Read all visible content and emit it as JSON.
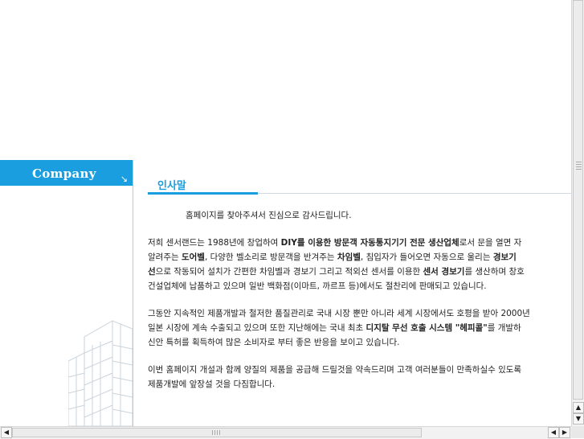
{
  "sidebar": {
    "title": "Company",
    "arrow_icon": "↘",
    "illustration": "building-illustration"
  },
  "content": {
    "title": "인사말",
    "greeting": "홈페이지를 찾아주셔서 진심으로 감사드립니다.",
    "p1": {
      "l1a": "저희 센서랜드는 1988년에 창업하여 ",
      "l1b": "DIY를 이용한 방문객 자동통지기기 전문 생산업체",
      "l1c": "로서 문을 열면 자",
      "l2a": "알려주는 ",
      "l2b": "도어벨",
      "l2c": ", 다양한 벨소리로 방문객을 반겨주는 ",
      "l2d": "차임벨",
      "l2e": ", 침입자가 들어오면 자동으로 울리는 ",
      "l2f": "경보기",
      "l3a": "선",
      "l3b": "으로 작동되어 설치가 간편한 차임벨과 경보기 그리고 적외선 센서를 이용한 ",
      "l3c": "센서 경보기",
      "l3d": "를 생산하며 창호",
      "l4": "건설업체에 납품하고 있으며 일반 백화점(이마트, 까르프 등)에서도 절찬리에 판매되고 있습니다."
    },
    "p2": {
      "l1": "그동안 지속적인 제품개발과 철저한 품질관리로 국내 시장 뿐만 아니라 세계 시장에서도 호평을 받아 2000년",
      "l2a": "일본 시장에 계속 수출되고 있으며 또한 지난해에는 국내 최초 ",
      "l2b": "디지탈 무선 호출 시스템 \"헤피콜\"",
      "l2c": "를 개발하",
      "l3": "신안 특허를 획득하여 많은 소비자로 부터 좋은 반응을 보이고 있습니다."
    },
    "p3": {
      "l1": "이번 홈페이지 개설과 함께 양질의 제품을 공급해 드릴것을 약속드리며 고객 여러분들이 만족하실수 있도록",
      "l2": "제품개발에 앞장설 것을 다짐합니다."
    }
  },
  "scrollbar": {
    "up_icon": "▲",
    "down_icon": "▼",
    "left_icon": "◀",
    "right_icon": "▶"
  }
}
